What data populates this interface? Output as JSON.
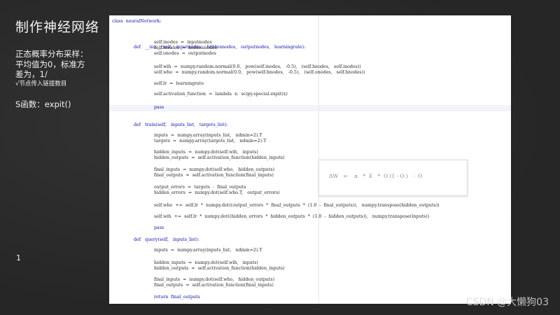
{
  "slide": {
    "title": "制作神经网络",
    "page_number": "1"
  },
  "notes": {
    "line1": "正态概率分布采样：",
    "line2": "平均值为0，标准方",
    "line3": "差为，1/",
    "line4": "√节点传入链接数目",
    "s_function": "S函数：expit()"
  },
  "code": [
    {
      "text": "class  neuralNetwork:",
      "kw": true,
      "indent": 0
    },
    {
      "text": "def   __init__(self,   inputnodes,   hiddennodes,   outputnodes,   learningrate):",
      "kw": true,
      "indent": 1
    },
    {
      "text": "self.inodes  =  inputnodes",
      "kw": false,
      "indent": 2
    },
    {
      "text": "self.hnodes  =  hiddennodes",
      "kw": false,
      "indent": 2
    },
    {
      "text": "self.onodes  =  outputnodes",
      "kw": false,
      "indent": 2
    },
    {
      "text": "self.wih  =  numpy.random.normal(0.0,   pow(self.inodes,   -0.5),   (self.hnodes,   self.inodes))",
      "kw": false,
      "indent": 2
    },
    {
      "text": "self.who  =  numpy.random.normal(0.0,   pow(self.hnodes,   -0.5),   (self.onodes,   self.hnodes))",
      "kw": false,
      "indent": 2
    },
    {
      "text": "self.lr  =  learningrate",
      "kw": false,
      "indent": 2
    },
    {
      "text": "self.activation_function  =  lambda  x:  scipy.special.expit(x)",
      "kw": false,
      "indent": 2
    },
    {
      "text": "pass",
      "kw": true,
      "indent": 2
    },
    {
      "text": "def   train(self,   inputs_list,   targets_list):",
      "kw": true,
      "indent": 1
    },
    {
      "text": "inputs  =  numpy.array(inputs_list,   ndmin=2).T",
      "kw": false,
      "indent": 2
    },
    {
      "text": "targets  =  numpy.array(targets_list,   ndmin=2).T",
      "kw": false,
      "indent": 2
    },
    {
      "text": "hidden_inputs  =  numpy.dot(self.wih,   inputs)",
      "kw": false,
      "indent": 2
    },
    {
      "text": "hidden_outputs  =  self.activation_function(hidden_inputs)",
      "kw": false,
      "indent": 2
    },
    {
      "text": "final_inputs  =  numpy.dot(self.who,   hidden_outputs)",
      "kw": false,
      "indent": 2
    },
    {
      "text": "final_outputs  =  self.activation_function(final_inputs)",
      "kw": false,
      "indent": 2
    },
    {
      "text": "output_errors  =  targets  -  final_outputs",
      "kw": false,
      "indent": 2
    },
    {
      "text": "hidden_errors  =  numpy.dot(self.who.T,   output_errors)",
      "kw": false,
      "indent": 2
    },
    {
      "text": "self.who  +=  self.lr  *  numpy.dot((output_errors  *  final_outputs  *  (1.0  -  final_outputs)),   numpy.transpose(hidden_outputs))",
      "kw": false,
      "indent": 2
    },
    {
      "text": "self.wih  +=  self.lr  *  numpy.dot((hidden_errors  *  hidden_outputs  *  (1.0  -  hidden_outputs)),   numpy.transpose(inputs))",
      "kw": false,
      "indent": 2
    },
    {
      "text": "pass",
      "kw": true,
      "indent": 2
    },
    {
      "text": "def   query(self,   inputs_list):",
      "kw": true,
      "indent": 1
    },
    {
      "text": "inputs  =  numpy.array(inputs_list,   ndmin=2).T",
      "kw": false,
      "indent": 2
    },
    {
      "text": "hidden_inputs  =  numpy.dot(self.wih,   inputs)",
      "kw": false,
      "indent": 2
    },
    {
      "text": "hidden_outputs  =  self.activation_function(hidden_inputs)",
      "kw": false,
      "indent": 2
    },
    {
      "text": "final_inputs  =  numpy.dot(self.who,   hidden_outputs)",
      "kw": false,
      "indent": 2
    },
    {
      "text": "final_outputs  =  self.activation_function(final_inputs)",
      "kw": false,
      "indent": 2
    },
    {
      "text": "return  final_outputs",
      "kw": true,
      "indent": 2
    }
  ],
  "formula": "ΔW   =    α   *  E   *  O (1 - O )   ·  O",
  "watermark": "CSDN @大懒狗03"
}
